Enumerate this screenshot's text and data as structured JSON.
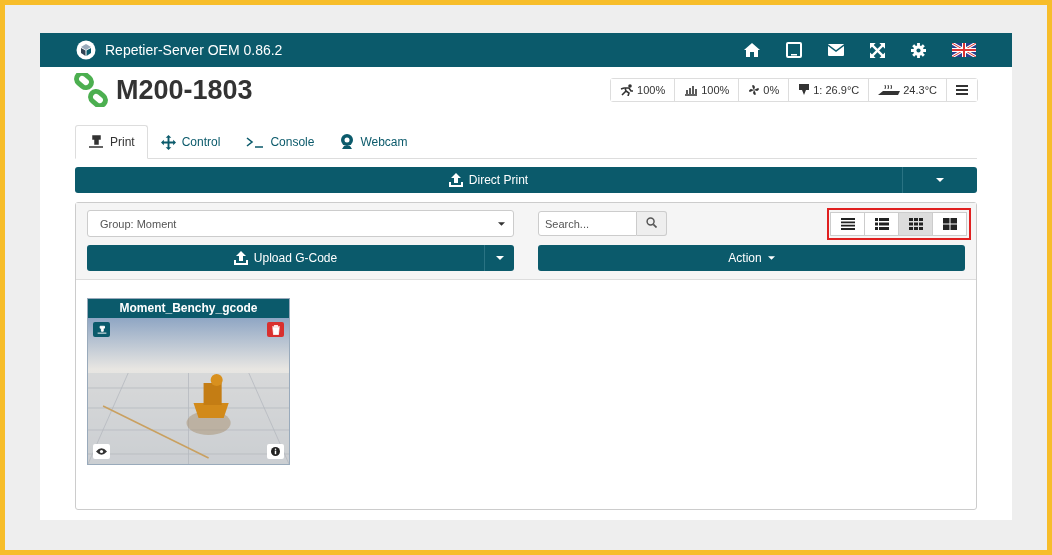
{
  "navbar": {
    "title": "Repetier-Server OEM 0.86.2"
  },
  "printer": {
    "name": "M200-1803",
    "connected": true
  },
  "status": [
    {
      "kind": "speed",
      "text": "100%"
    },
    {
      "kind": "flow",
      "text": "100%"
    },
    {
      "kind": "fan",
      "text": "0%"
    },
    {
      "kind": "extruder",
      "text": "1: 26.9°C"
    },
    {
      "kind": "bed",
      "text": "24.3°C"
    }
  ],
  "tabs": [
    {
      "kind": "print",
      "label": "Print",
      "selected": true
    },
    {
      "kind": "control",
      "label": "Control",
      "selected": false
    },
    {
      "kind": "console",
      "label": "Console",
      "selected": false
    },
    {
      "kind": "webcam",
      "label": "Webcam",
      "selected": false
    }
  ],
  "direct_print": {
    "label": "Direct Print"
  },
  "group_select": {
    "value": "Group: Moment"
  },
  "search": {
    "placeholder": "Search..."
  },
  "upload": {
    "label": "Upload G-Code"
  },
  "action": {
    "label": "Action"
  },
  "view_modes": {
    "highlighted": true,
    "items": [
      {
        "kind": "lines",
        "selected": false
      },
      {
        "kind": "list",
        "selected": false
      },
      {
        "kind": "grid",
        "selected": true
      },
      {
        "kind": "tiles",
        "selected": false
      }
    ]
  },
  "files": [
    {
      "name": "Moment_Benchy_gcode",
      "kind": "picture"
    }
  ]
}
